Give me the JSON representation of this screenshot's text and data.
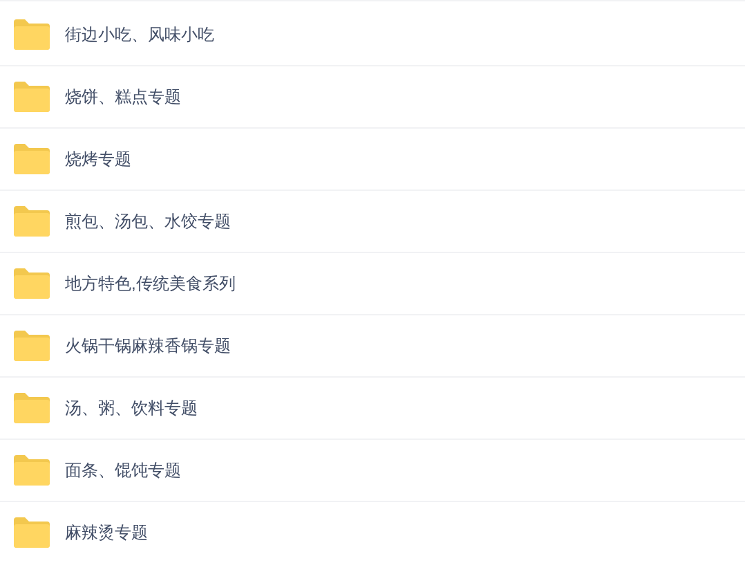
{
  "folders": [
    {
      "name": "街边小吃、风味小吃"
    },
    {
      "name": "烧饼、糕点专题"
    },
    {
      "name": "烧烤专题"
    },
    {
      "name": "煎包、汤包、水饺专题"
    },
    {
      "name": "地方特色,传统美食系列"
    },
    {
      "name": "火锅干锅麻辣香锅专题"
    },
    {
      "name": "汤、粥、饮料专题"
    },
    {
      "name": "面条、馄饨专题"
    },
    {
      "name": "麻辣烫专题"
    }
  ]
}
